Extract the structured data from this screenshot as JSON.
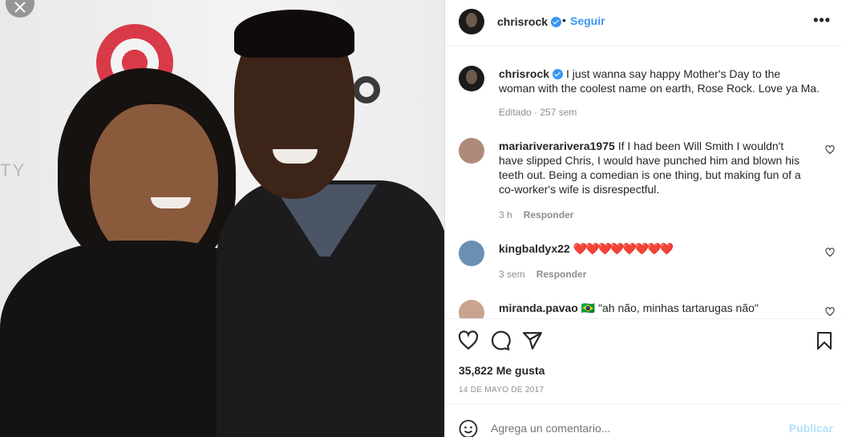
{
  "header": {
    "username": "chrisrock",
    "separator": "•",
    "follow_label": "Seguir",
    "more_label": "•••"
  },
  "caption": {
    "username": "chrisrock",
    "text": "I just wanna say happy Mother's Day to the woman with the coolest name on earth, Rose Rock. Love ya Ma.",
    "meta": "Editado · 257 sem"
  },
  "comments": [
    {
      "username": "mariariverarivera1975",
      "text": "If I had been Will Smith I wouldn't have slipped Chris, I would have punched him and blown his teeth out. Being a comedian is one thing, but making fun of a co-worker's wife is disrespectful.",
      "time": "3 h",
      "reply": "Responder",
      "avatar_color": "#b08a78"
    },
    {
      "username": "kingbaldyx22",
      "text": "❤️❤️❤️❤️❤️❤️❤️❤️",
      "time": "3 sem",
      "reply": "Responder",
      "avatar_color": "#6b8fb2"
    },
    {
      "username": "miranda.pavao",
      "text": "🇧🇷 \"ah não, minhas tartarugas não\"",
      "time": "",
      "reply": "",
      "avatar_color": "#c9a38f"
    }
  ],
  "stats": {
    "likes": "35,822 Me gusta",
    "date": "14 DE MAYO DE 2017"
  },
  "add_comment": {
    "placeholder": "Agrega un comentario...",
    "publish_label": "Publicar"
  },
  "photo": {
    "bg_text": "TY"
  },
  "colors": {
    "accent": "#3897f0",
    "publish_disabled": "#b2dffc",
    "muted": "#8e8e8e",
    "heart": "#e0245e"
  }
}
